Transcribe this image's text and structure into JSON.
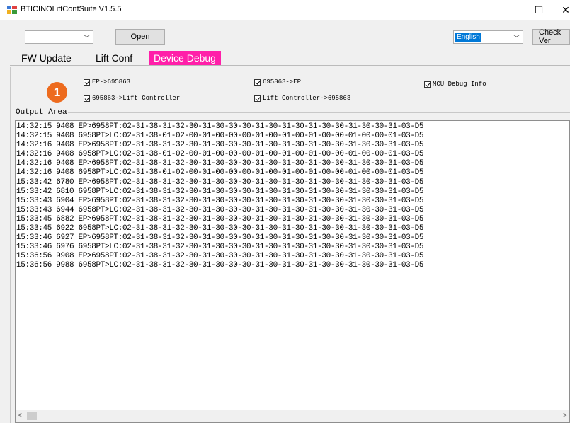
{
  "window": {
    "title": "BTICINOLiftConfSuite V1.5.5",
    "minimize": "–",
    "maximize": "☐",
    "close": "✕"
  },
  "toolbar": {
    "port_value": "",
    "open_label": "Open",
    "language_value": "English",
    "check_ver_label": "Check Ver"
  },
  "tabs": {
    "fw_update": "FW Update",
    "lift_conf": "Lift Conf",
    "device_debug": "Device Debug",
    "active_color": "#ff1fa9"
  },
  "debug": {
    "badge": "1",
    "badge_color": "#ed6b1e",
    "checkboxes": {
      "ep_to_695863": "EP->695863",
      "p695863_to_ep": "695863->EP",
      "mcu_debug": "MCU Debug Info",
      "p695863_to_lc": "695863->Lift Controller",
      "lc_to_695863": "Lift Controller->695863"
    },
    "output_label": "Output Area",
    "log": [
      "14:32:15 9408   EP>6958PT:02-31-38-31-32-30-31-30-30-30-31-30-31-30-31-30-30-31-30-30-31-03-D5",
      "14:32:15 9408   6958PT>LC:02-31-38-01-02-00-01-00-00-00-01-00-01-00-01-00-00-01-00-00-01-03-D5",
      "14:32:16 9408   EP>6958PT:02-31-38-31-32-30-31-30-30-30-31-30-31-30-31-30-30-31-30-30-31-03-D5",
      "14:32:16 9408   6958PT>LC:02-31-38-01-02-00-01-00-00-00-01-00-01-00-01-00-00-01-00-00-01-03-D5",
      "14:32:16 9408   EP>6958PT:02-31-38-31-32-30-31-30-30-30-31-30-31-30-31-30-30-31-30-30-31-03-D5",
      "14:32:16 9408   6958PT>LC:02-31-38-01-02-00-01-00-00-00-01-00-01-00-01-00-00-01-00-00-01-03-D5",
      "15:33:42 6780   EP>6958PT:02-31-38-31-32-30-31-30-30-30-31-30-31-30-31-30-30-31-30-30-31-03-D5",
      "15:33:42 6810   6958PT>LC:02-31-38-31-32-30-31-30-30-30-31-30-31-30-31-30-30-31-30-30-31-03-D5",
      "15:33:43 6904   EP>6958PT:02-31-38-31-32-30-31-30-30-30-31-30-31-30-31-30-30-31-30-30-31-03-D5",
      "15:33:43 6944   6958PT>LC:02-31-38-31-32-30-31-30-30-30-31-30-31-30-31-30-30-31-30-30-31-03-D5",
      "15:33:45 6882   EP>6958PT:02-31-38-31-32-30-31-30-30-30-31-30-31-30-31-30-30-31-30-30-31-03-D5",
      "15:33:45 6922   6958PT>LC:02-31-38-31-32-30-31-30-30-30-31-30-31-30-31-30-30-31-30-30-31-03-D5",
      "15:33:46 6927   EP>6958PT:02-31-38-31-32-30-31-30-30-30-31-30-31-30-31-30-30-31-30-30-31-03-D5",
      "15:33:46 6976   6958PT>LC:02-31-38-31-32-30-31-30-30-30-31-30-31-30-31-30-30-31-30-30-31-03-D5",
      "15:36:56 9908   EP>6958PT:02-31-38-31-32-30-31-30-30-30-31-30-31-30-31-30-30-31-30-30-31-03-D5",
      "15:36:56 9988   6958PT>LC:02-31-38-31-32-30-31-30-30-30-31-30-31-30-31-30-30-31-30-30-31-03-D5"
    ]
  }
}
